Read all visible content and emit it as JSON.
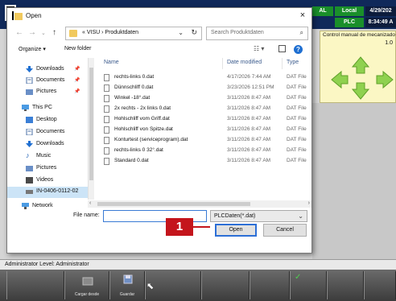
{
  "hmi": {
    "local_label": "Local",
    "plc_label": "PLC",
    "date": "4/29/202",
    "time": "8:34:49 A",
    "visu_label": "AL",
    "panel_title": "Control manual de mecanizado",
    "panel_value": "1.0",
    "user_text": "Administrator  Level: Administrator",
    "softkeys": [
      {
        "label": "Cargar desde",
        "icon": "load-icon"
      },
      {
        "label": "Guardar",
        "icon": "save-disk-icon"
      },
      {
        "label": "",
        "icon": "check-icon"
      }
    ]
  },
  "dialog": {
    "title": "Open",
    "close_glyph": "×",
    "address": "«  VISU  ›  Produktdaten",
    "search_placeholder": "Search Produktdaten",
    "organize_label": "Organize ▾",
    "new_folder_label": "New folder",
    "nav_items": [
      {
        "label": "Downloads",
        "icon": "download-icon",
        "pinned": true
      },
      {
        "label": "Documents",
        "icon": "documents-icon",
        "pinned": true
      },
      {
        "label": "Pictures",
        "icon": "pictures-icon",
        "pinned": true
      },
      {
        "label": "This PC",
        "icon": "computer-icon",
        "pinned": false
      },
      {
        "label": "Desktop",
        "icon": "desktop-icon",
        "pinned": false
      },
      {
        "label": "Documents",
        "icon": "documents-icon",
        "pinned": false
      },
      {
        "label": "Downloads",
        "icon": "download-icon",
        "pinned": false
      },
      {
        "label": "Music",
        "icon": "music-icon",
        "pinned": false
      },
      {
        "label": "Pictures",
        "icon": "pictures-icon",
        "pinned": false
      },
      {
        "label": "Videos",
        "icon": "videos-icon",
        "pinned": false
      },
      {
        "label": "IN-0406-0112-02",
        "icon": "drive-icon",
        "pinned": false
      },
      {
        "label": "Network",
        "icon": "network-icon",
        "pinned": false
      }
    ],
    "columns": {
      "name": "Name",
      "date": "Date modified",
      "type": "Type"
    },
    "files": [
      {
        "name": "rechts-links 0.dat",
        "date": "4/17/2026 7:44 AM",
        "type": "DAT File"
      },
      {
        "name": "Dünnschliff 0.dat",
        "date": "3/23/2026 12:51 PM",
        "type": "DAT File"
      },
      {
        "name": "Winkel -18°.dat",
        "date": "3/11/2026 8:47 AM",
        "type": "DAT File"
      },
      {
        "name": "2x rechts - 2x links 0.dat",
        "date": "3/11/2026 8:47 AM",
        "type": "DAT File"
      },
      {
        "name": "Hohlschliff vom Griff.dat",
        "date": "3/11/2026 8:47 AM",
        "type": "DAT File"
      },
      {
        "name": "Hohlschliff von Spitze.dat",
        "date": "3/11/2026 8:47 AM",
        "type": "DAT File"
      },
      {
        "name": "Konturtest (serviceprogram).dat",
        "date": "3/11/2026 8:47 AM",
        "type": "DAT File"
      },
      {
        "name": "rechts-links 0 32°.dat",
        "date": "3/11/2026 8:47 AM",
        "type": "DAT File"
      },
      {
        "name": "Standard 0.dat",
        "date": "3/11/2026 8:47 AM",
        "type": "DAT File"
      }
    ],
    "file_name_label": "File name:",
    "file_name_value": "",
    "filter_value": "PLCDaten(*.dat)",
    "open_label": "Open",
    "cancel_label": "Cancel"
  },
  "callout": {
    "number": "1",
    "color": "#c4151c"
  }
}
